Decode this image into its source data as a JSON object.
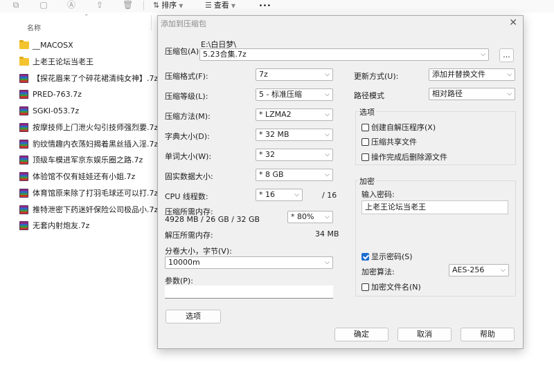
{
  "toolbar": {
    "sort_label": "排序",
    "view_label": "查看",
    "more_label": "..."
  },
  "explorer": {
    "column_name": "名称",
    "files": [
      {
        "name": "__MACOSX",
        "type": "folder"
      },
      {
        "name": "上老王论坛当老王",
        "type": "folder"
      },
      {
        "name": "【探花眉来了个碎花裙清纯女神】.7z",
        "type": "archive"
      },
      {
        "name": "PRED-763.7z",
        "type": "archive"
      },
      {
        "name": "SGKI-053.7z",
        "type": "archive"
      },
      {
        "name": "按摩技师上门泄火勾引技师强烈要.7z",
        "type": "archive"
      },
      {
        "name": "豹纹情趣内衣荡妇揭着黑丝插入淫.7z",
        "type": "archive"
      },
      {
        "name": "顶级车模进军京东娱乐圈之路.7z",
        "type": "archive"
      },
      {
        "name": "体验馆不仅有娃娃还有小姐.7z",
        "type": "archive"
      },
      {
        "name": "体育馆原来除了打羽毛球还可以打.7z",
        "type": "archive"
      },
      {
        "name": "推特泄密下药迷奸保险公司极品小.7z",
        "type": "archive"
      },
      {
        "name": "无套内射炮友.7z",
        "type": "archive"
      }
    ]
  },
  "dialog": {
    "title": "添加到压缩包",
    "archive_label": "压缩包(A)",
    "archive_path": "E:\\白日梦\\",
    "archive_name": "5.23合集.7z",
    "browse_label": "...",
    "format_label": "压缩格式(F):",
    "format_value": "7z",
    "level_label": "压缩等级(L):",
    "level_value": "5 - 标准压缩",
    "method_label": "压缩方法(M):",
    "method_value": "* LZMA2",
    "dict_label": "字典大小(D):",
    "dict_value": "* 32 MB",
    "word_label": "单词大小(W):",
    "word_value": "* 32",
    "solid_label": "固实数据大小:",
    "solid_value": "* 8 GB",
    "threads_label": "CPU 线程数:",
    "threads_value": "* 16",
    "threads_total": "/ 16",
    "mem_comp_label": "压缩所需内存:",
    "mem_comp_values": "4928 MB / 26 GB / 32 GB",
    "mem_comp_percent": "* 80%",
    "mem_decomp_label": "解压所需内存:",
    "mem_decomp_value": "34 MB",
    "split_label": "分卷大小，字节(V):",
    "split_value": "10000m",
    "params_label": "参数(P):",
    "params_value": "",
    "options_button": "选项",
    "update_label": "更新方式(U):",
    "update_value": "添加并替换文件",
    "path_mode_label": "路径模式",
    "path_mode_value": "相对路径",
    "options_group_title": "选项",
    "opt_sfx": "创建自解压程序(X)",
    "opt_shared": "压缩共享文件",
    "opt_delete": "操作完成后删除源文件",
    "encryption_group_title": "加密",
    "password_label": "输入密码:",
    "password_value": "上老王论坛当老王",
    "show_password_label": "显示密码(S)",
    "enc_method_label": "加密算法:",
    "enc_method_value": "AES-256",
    "enc_names_label": "加密文件名(N)",
    "ok_button": "确定",
    "cancel_button": "取消",
    "help_button": "帮助"
  }
}
